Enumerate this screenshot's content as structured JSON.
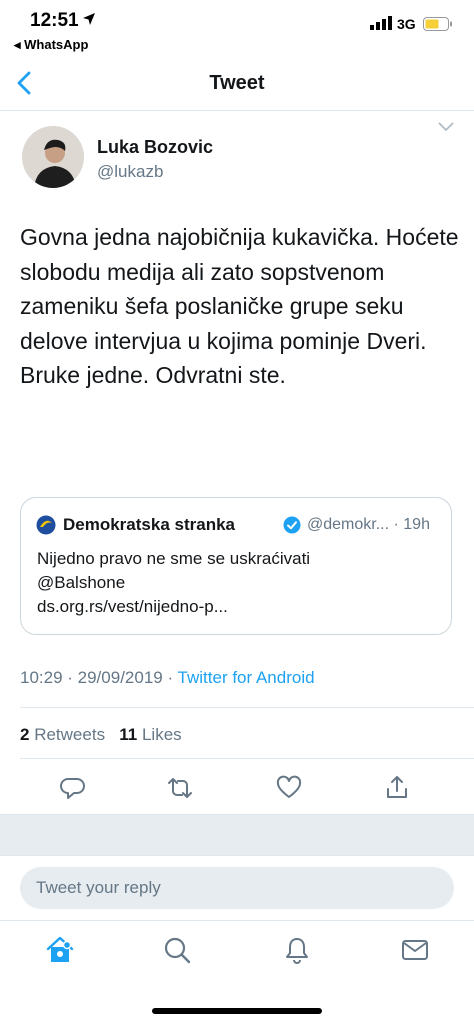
{
  "status_bar": {
    "time": "12:51",
    "back_app": "◂ WhatsApp",
    "network": "3G"
  },
  "nav": {
    "title": "Tweet"
  },
  "tweet": {
    "author_name": "Luka Bozovic",
    "author_handle": "@lukazb",
    "text": "Govna jedna najobičnija kukavička. Hoćete slobodu medija ali zato sopstvenom zameniku šefa poslaničke grupe seku delove intervjua u kojima pominje Dveri. Bruke jedne. Odvratni ste.",
    "timestamp": "10:29 · 29/09/2019 · ",
    "source": "Twitter for Android",
    "retweets_count": "2",
    "retweets_label": "Retweets",
    "likes_count": "11",
    "likes_label": "Likes"
  },
  "quote": {
    "name": "Demokratska stranka",
    "meta": "@demokr... · 19h",
    "line1": "Nijedno pravo ne sme se uskraćivati",
    "line2": "@Balshone",
    "line3": "ds.org.rs/vest/nijedno-p..."
  },
  "reply": {
    "placeholder": "Tweet your reply"
  },
  "colors": {
    "accent": "#1da1f2",
    "secondary_text": "#657786",
    "divider": "#e1e8ed",
    "battery": "#f5d03b"
  },
  "icons": {
    "actions": [
      "reply-icon",
      "retweet-icon",
      "like-icon",
      "share-icon"
    ],
    "tabs": [
      "home-icon",
      "search-icon",
      "notifications-icon",
      "messages-icon"
    ]
  }
}
